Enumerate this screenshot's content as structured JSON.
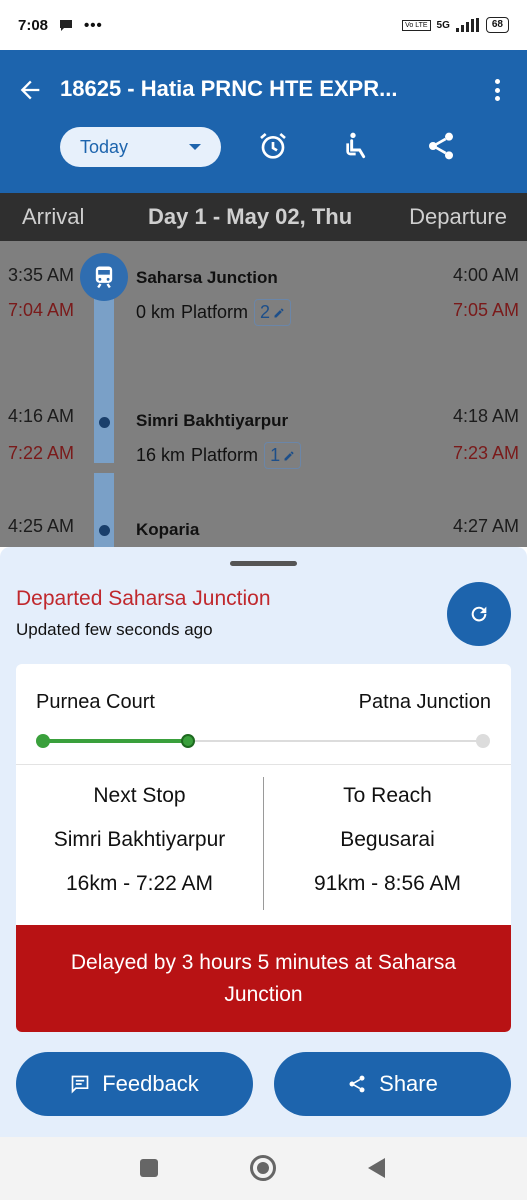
{
  "status_bar": {
    "time": "7:08",
    "network": "5G",
    "volte": "Vo LTE",
    "battery": "68"
  },
  "app_bar": {
    "title": "18625 - Hatia PRNC HTE EXPR...",
    "date_selector": "Today",
    "icons": [
      "back-arrow-icon",
      "alarm-icon",
      "seat-icon",
      "share-icon",
      "more-vert-icon"
    ],
    "accent_color": "#1d64ad"
  },
  "day_header": {
    "arrival": "Arrival",
    "day": "Day 1 - May 02, Thu",
    "departure": "Departure"
  },
  "stops": [
    {
      "name": "Saharsa Junction",
      "km": "0 km",
      "platform_label": "Platform",
      "platform": "2",
      "sched_arr": "3:35 AM",
      "actual_arr": "7:04 AM",
      "sched_dep": "4:00 AM",
      "actual_dep": "7:05 AM"
    },
    {
      "name": "Simri Bakhtiyarpur",
      "km": "16 km",
      "platform_label": "Platform",
      "platform": "1",
      "sched_arr": "4:16 AM",
      "actual_arr": "7:22 AM",
      "sched_dep": "4:18 AM",
      "actual_dep": "7:23 AM"
    },
    {
      "name": "Koparia",
      "sched_arr": "4:25 AM",
      "sched_dep": "4:27 AM"
    }
  ],
  "sheet": {
    "status": "Departed Saharsa Junction",
    "updated": "Updated few seconds ago",
    "route_from": "Purnea Court",
    "route_to": "Patna Junction",
    "progress": 0.33,
    "next_stop": {
      "label": "Next Stop",
      "station": "Simri Bakhtiyarpur",
      "eta": "16km - 7:22 AM"
    },
    "to_reach": {
      "label": "To Reach",
      "station": "Begusarai",
      "eta": "91km - 8:56 AM"
    },
    "delay": "Delayed by 3 hours 5 minutes at Saharsa Junction",
    "feedback_button": "Feedback",
    "share_button": "Share",
    "delay_color": "#b81214"
  }
}
